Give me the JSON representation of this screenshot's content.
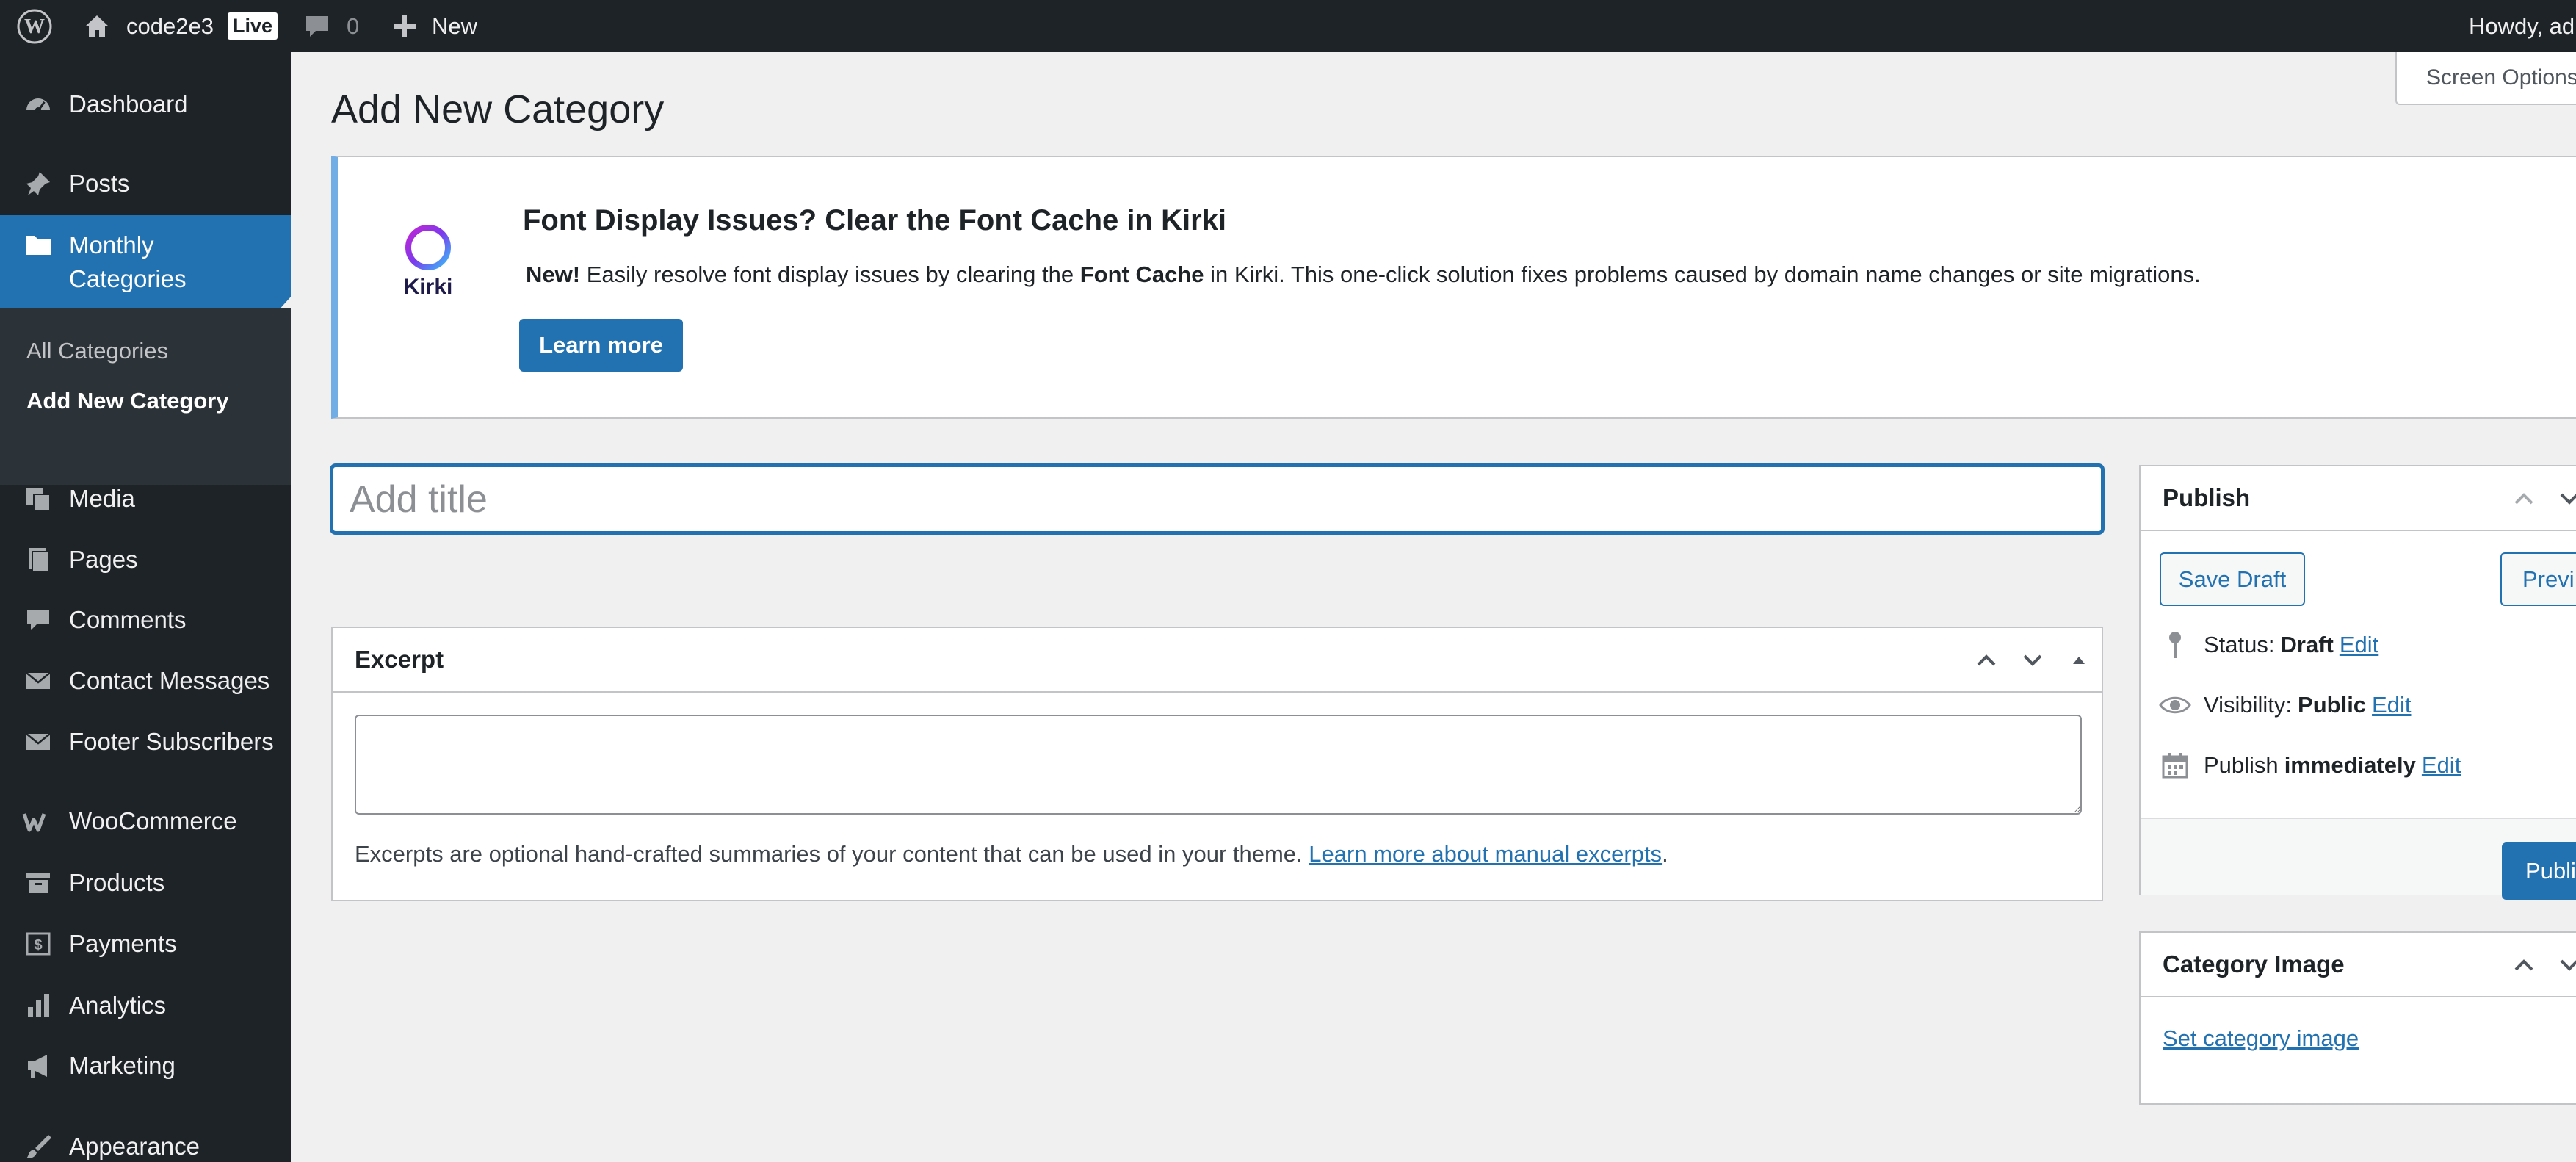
{
  "admin_bar": {
    "site_name": "code2e3",
    "live_badge": "Live",
    "comments_count": "0",
    "new_label": "New",
    "howdy": "Howdy, ad"
  },
  "sidebar": {
    "items": [
      {
        "label": "Dashboard",
        "icon": "dashboard-icon"
      },
      {
        "label": "Posts",
        "icon": "pushpin-icon"
      },
      {
        "label": "Monthly Categories",
        "icon": "folder-icon"
      },
      {
        "label": "Media",
        "icon": "media-icon"
      },
      {
        "label": "Pages",
        "icon": "pages-icon"
      },
      {
        "label": "Comments",
        "icon": "comment-icon"
      },
      {
        "label": "Contact Messages",
        "icon": "email-icon"
      },
      {
        "label": "Footer Subscribers",
        "icon": "email-icon"
      },
      {
        "label": "WooCommerce",
        "icon": "woocommerce-icon"
      },
      {
        "label": "Products",
        "icon": "archive-icon"
      },
      {
        "label": "Payments",
        "icon": "payments-icon"
      },
      {
        "label": "Analytics",
        "icon": "bar-chart-icon"
      },
      {
        "label": "Marketing",
        "icon": "megaphone-icon"
      },
      {
        "label": "Appearance",
        "icon": "paintbrush-icon"
      }
    ],
    "current_item": "Monthly Categories",
    "submenu": [
      "All Categories",
      "Add New Category"
    ],
    "submenu_active": "Add New Category"
  },
  "screen_options": "Screen Options",
  "page_title": "Add New Category",
  "notice": {
    "title": "Font Display Issues? Clear the Font Cache in Kirki",
    "logo_text": "Kirki",
    "text_new": "New!",
    "text_part1": "Easily resolve font display issues by clearing the",
    "text_bold": "Font Cache",
    "text_part2": "in Kirki. This one-click solution fixes problems caused by domain name changes or site migrations.",
    "button": "Learn more"
  },
  "title_placeholder": "Add title",
  "excerpt": {
    "heading": "Excerpt",
    "help_text": "Excerpts are optional hand-crafted summaries of your content that can be used in your theme.",
    "help_link": "Learn more about manual excerpts",
    "help_end": "."
  },
  "publish": {
    "heading": "Publish",
    "save_draft": "Save Draft",
    "preview": "Previ",
    "status_label": "Status:",
    "status_value": "Draft",
    "visibility_label": "Visibility:",
    "visibility_value": "Public",
    "publish_label": "Publish",
    "publish_value": "immediately",
    "edit": "Edit",
    "publish_button": "Publi"
  },
  "category_image": {
    "heading": "Category Image",
    "link": "Set category image"
  },
  "colors": {
    "admin_dark": "#1d2327",
    "accent": "#2271b1",
    "background": "#f0f0f1",
    "notice_border": "#72aee6"
  }
}
